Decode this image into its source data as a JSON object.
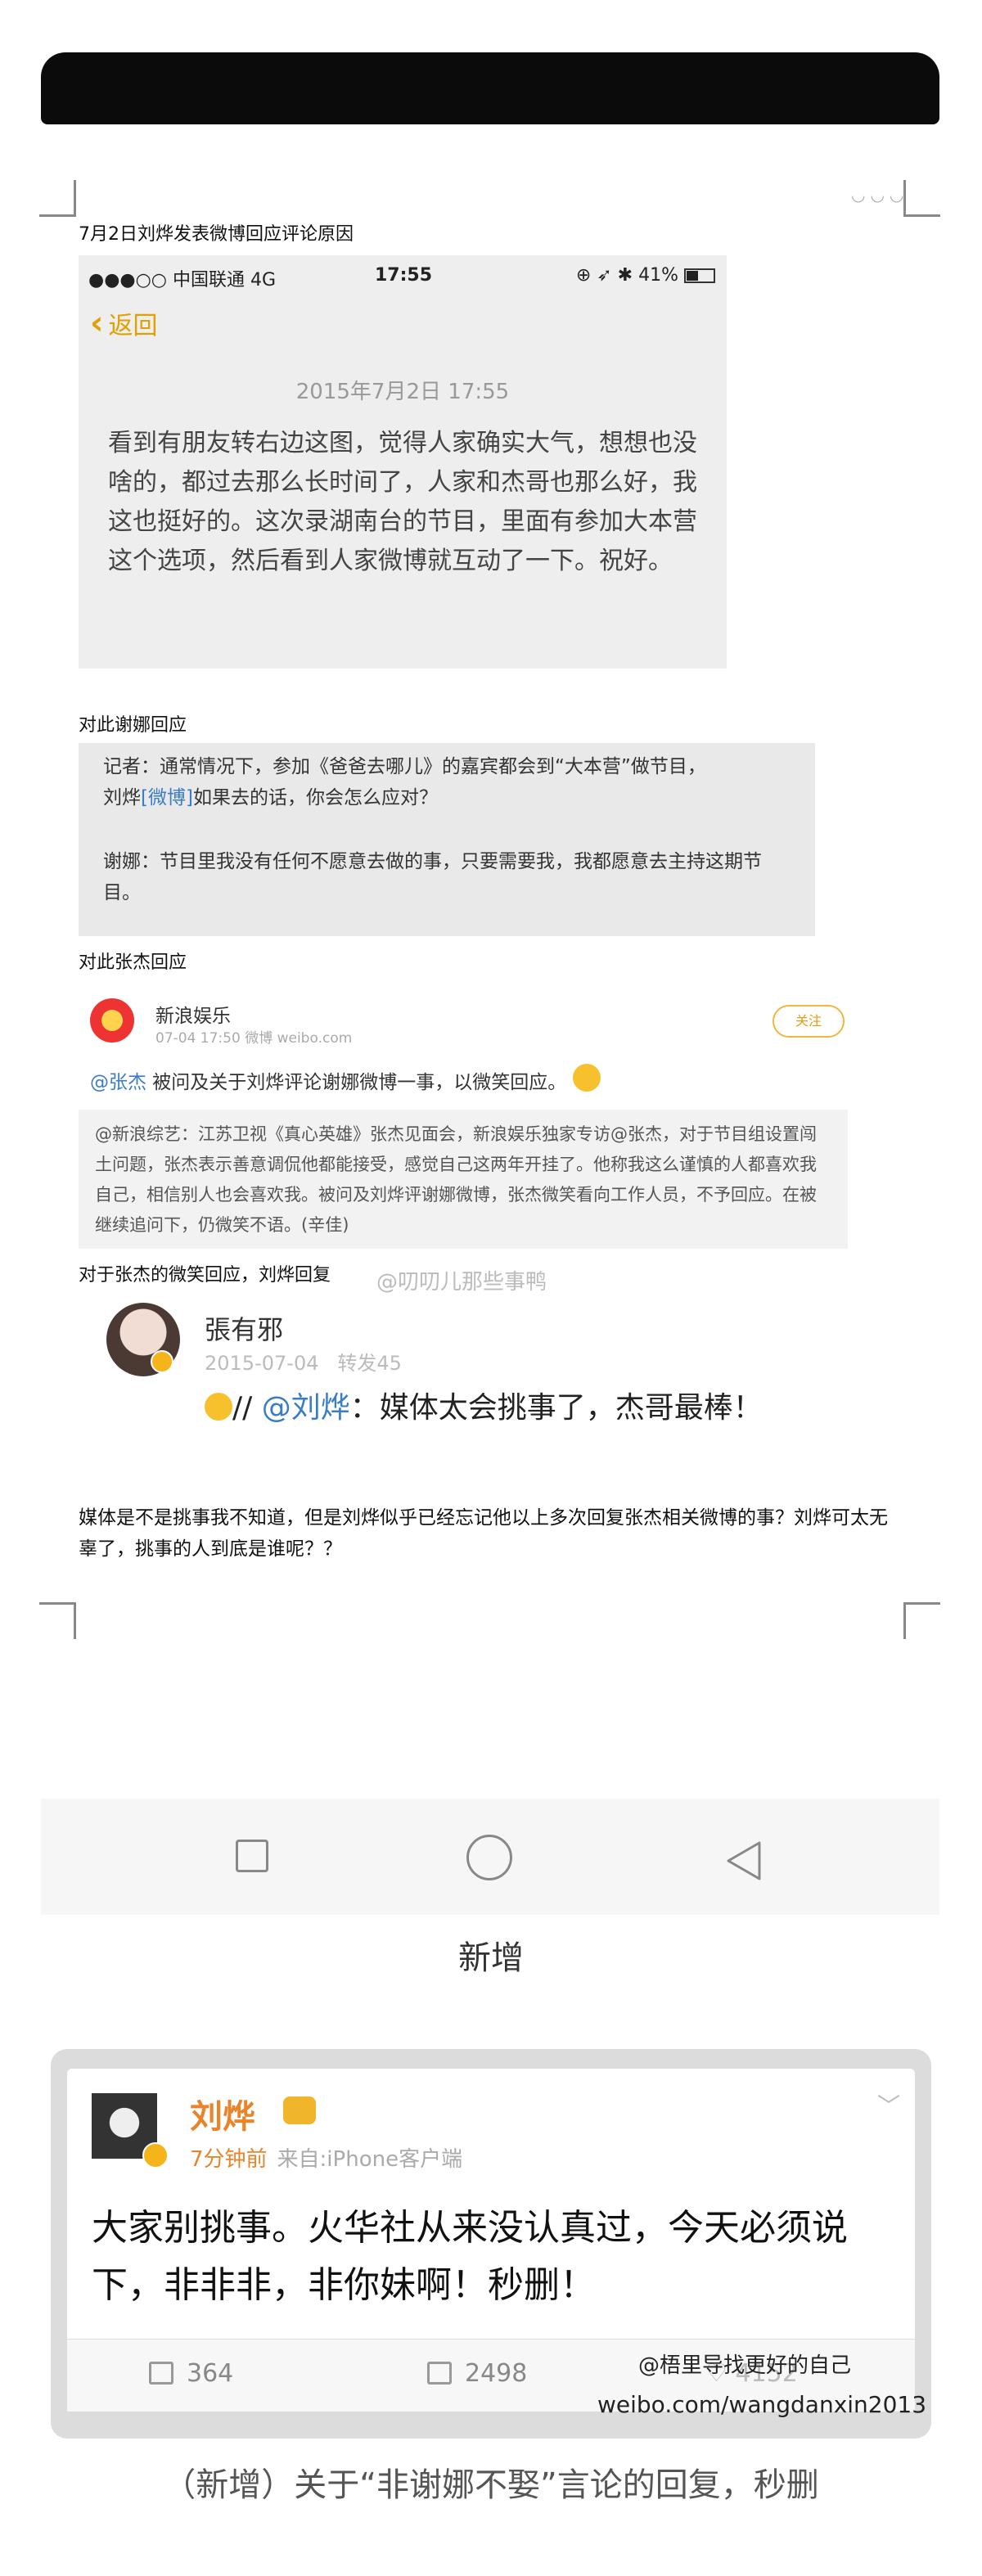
{
  "section1": {
    "caption": "7月2日刘烨发表微博回应评论原因",
    "phone": {
      "status_left": "●●●○○ 中国联通  4G",
      "status_time": "17:55",
      "status_right": "41%",
      "back_label": "返回",
      "date": "2015年7月2日 17:55",
      "body": "看到有朋友转右边这图，觉得人家确实大气，想想也没啥的，都过去那么长时间了，人家和杰哥也那么好，我这也挺好的。这次录湖南台的节目，里面有参加大本营这个选项，然后看到人家微博就互动了一下。祝好。"
    }
  },
  "section2": {
    "caption": "对此谢娜回应",
    "reporter_a": "记者：通常情况下，参加《爸爸去哪儿》的嘉宾都会到“大本营”做节目，",
    "reporter_b1": "刘烨",
    "reporter_link": "[微博]",
    "reporter_b2": "如果去的话，你会怎么应对？",
    "answer": "谢娜：节目里我没有任何不愿意去做的事，只要需要我，我都愿意去主持这期节目。"
  },
  "section3": {
    "caption": "对此张杰回应",
    "weibo": {
      "name": "新浪娱乐",
      "meta": "07-04 17:50 微博 weibo.com",
      "follow": "关注",
      "mention": "@张杰",
      "text": " 被问及关于刘烨评论谢娜微博一事，以微笑回应。",
      "repost": "@新浪综艺：江苏卫视《真心英雄》张杰见面会，新浪娱乐独家专访@张杰，对于节目组设置闯土问题，张杰表示善意调侃他都能接受，感觉自己这两年开挂了。他称我这么谨慎的人都喜欢我自己，相信别人也会喜欢我。被问及刘烨评谢娜微博，张杰微笑看向工作人员，不予回应。在被继续追问下，仍微笑不语。(辛佳)"
    }
  },
  "section4": {
    "caption": "对于张杰的微笑回应，刘烨回复",
    "watermark": "@叨叨儿那些事鸭",
    "name": "張有邪",
    "date": "2015-07-04",
    "repost": "转发45",
    "mention": "@刘烨",
    "text": "：媒体太会挑事了，杰哥最棒！"
  },
  "paragraph": "媒体是不是挑事我不知道，但是刘烨似乎已经忘记他以上多次回复张杰相关微博的事？刘烨可太无辜了，挑事的人到底是谁呢？？",
  "new_label": "新增",
  "bottom_post": {
    "name": "刘烨",
    "time": "7分钟前",
    "source": "来自:iPhone客户端",
    "text": "大家别挑事。火华社从来没认真过，今天必须说下，非非非，非你妹啊！秒删！",
    "reposts": "364",
    "comments": "2498",
    "likes": "4152",
    "watermark_user": "@梧里导找更好的自己",
    "watermark_site": "weibo.com/wangdanxin2013"
  },
  "footer_caption": "（新增）关于“非谢娜不娶”言论的回复，秒删",
  "icons": [
    "back-chevron-icon",
    "battery-icon",
    "smile-emoji-icon",
    "crown-icon",
    "verified-badge-icon",
    "chevron-down-icon",
    "repost-icon",
    "comment-icon",
    "like-icon",
    "nav-recent-icon",
    "nav-home-icon",
    "nav-back-icon"
  ]
}
